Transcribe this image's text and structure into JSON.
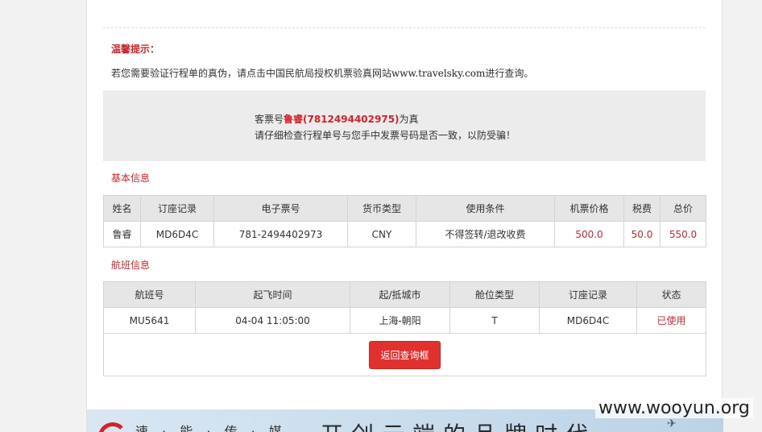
{
  "tips": {
    "title": "温馨提示：",
    "text_before": "若您需要验证行程单的真伪，请点击中国民航局授权机票验真网站",
    "site": "www.travelsky.com",
    "text_after": "进行查询。"
  },
  "verify": {
    "prefix": "客票号",
    "highlight": "鲁睿(7812494402975)",
    "suffix": "为真",
    "line2": "请仔细检查行程单号与您手中发票号码是否一致，以防受骗！"
  },
  "basic_info": {
    "label": "基本信息",
    "headers": [
      "姓名",
      "订座记录",
      "电子票号",
      "货币类型",
      "使用条件",
      "机票价格",
      "税费",
      "总价"
    ],
    "row": {
      "name": "鲁睿",
      "pnr": "MD6D4C",
      "eticket": "781-2494402973",
      "currency": "CNY",
      "conditions": "不得签转/退改收费",
      "fare": "500.0",
      "tax": "50.0",
      "total": "550.0"
    }
  },
  "flight_info": {
    "label": "航班信息",
    "headers": [
      "航班号",
      "起飞时间",
      "起/抵城市",
      "舱位类型",
      "订座记录",
      "状态"
    ],
    "row": {
      "flight_no": "MU5641",
      "departure": "04-04 11:05:00",
      "route": "上海-朝阳",
      "cabin": "T",
      "pnr": "MD6D4C",
      "status": "已使用"
    },
    "back_button": "返回查询框"
  },
  "banner": {
    "left": "速 · 能 · 传 · 媒",
    "slogan": "开创云端的品牌时代"
  },
  "watermark": "www.wooyun.org",
  "colors": {
    "accent_red": "#d0242b",
    "button_red": "#e0312f",
    "header_gray": "#e6e6e6"
  }
}
